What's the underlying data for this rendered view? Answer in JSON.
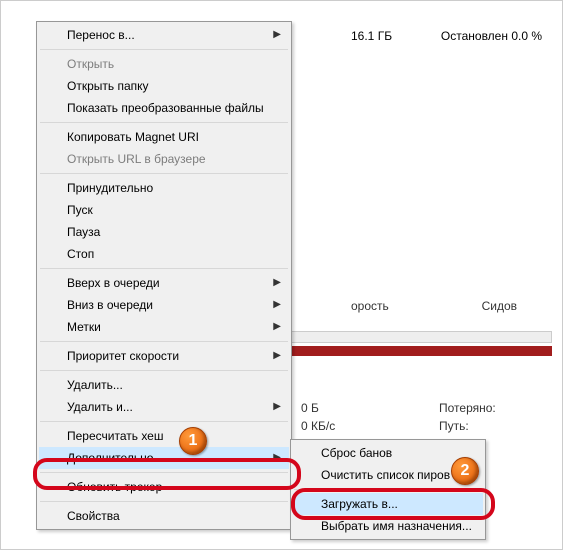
{
  "background": {
    "size": "16.1 ГБ",
    "status": "Остановлен 0.0 %",
    "speed_fragment": "орость",
    "seeds_fragment": "Сидов",
    "stat_bytes": "0 Б",
    "stat_speed": "0 КБ/с",
    "stat_lost": "Потеряно:",
    "stat_path": "Путь:"
  },
  "menu": {
    "move_to": "Перенос в...",
    "open": "Открыть",
    "open_folder": "Открыть папку",
    "show_converted": "Показать преобразованные файлы",
    "copy_magnet": "Копировать Magnet URI",
    "open_url": "Открыть URL в браузере",
    "force": "Принудительно",
    "start": "Пуск",
    "pause": "Пауза",
    "stop": "Стоп",
    "queue_up": "Вверх в очереди",
    "queue_down": "Вниз в очереди",
    "labels": "Метки",
    "speed_priority": "Приоритет скорости",
    "delete": "Удалить...",
    "delete_and": "Удалить и...",
    "recheck": "Пересчитать хеш",
    "advanced": "Дополнительно",
    "update_tracker": "Обновить трекер",
    "properties": "Свойства"
  },
  "submenu": {
    "reset_bans": "Сброс банов",
    "clear_peers": "Очистить список пиров",
    "download_to": "Загружать в...",
    "choose_dest": "Выбрать имя назначения..."
  },
  "annotations": {
    "step1": "1",
    "step2": "2"
  }
}
